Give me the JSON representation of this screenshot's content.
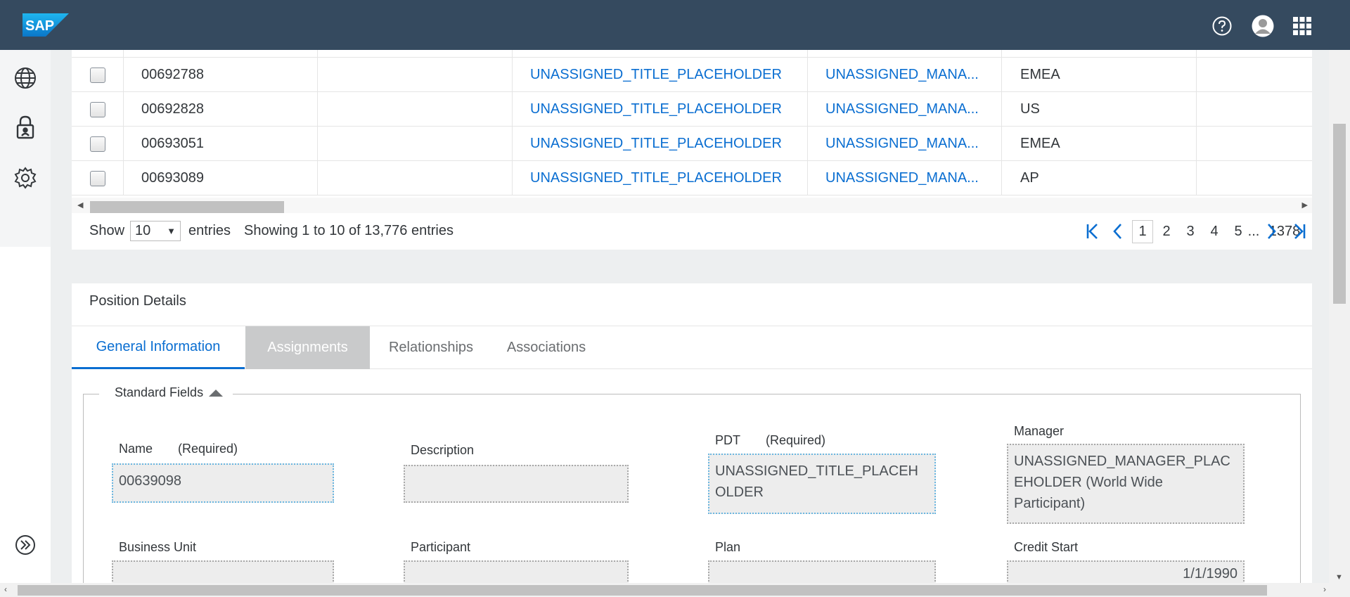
{
  "shell": {
    "logo_text": "SAP",
    "icons": [
      "help-icon",
      "user-avatar-icon",
      "app-grid-icon"
    ]
  },
  "sidenav": {
    "items": [
      "globe-icon",
      "lock-icon",
      "gear-icon"
    ],
    "expand": "expand-icon"
  },
  "table": {
    "rows": [
      {
        "id": "00692788",
        "title": "UNASSIGNED_TITLE_PLACEHOLDER",
        "manager": "UNASSIGNED_MANA...",
        "region": "EMEA"
      },
      {
        "id": "00692828",
        "title": "UNASSIGNED_TITLE_PLACEHOLDER",
        "manager": "UNASSIGNED_MANA...",
        "region": "US"
      },
      {
        "id": "00693051",
        "title": "UNASSIGNED_TITLE_PLACEHOLDER",
        "manager": "UNASSIGNED_MANA...",
        "region": "EMEA"
      },
      {
        "id": "00693089",
        "title": "UNASSIGNED_TITLE_PLACEHOLDER",
        "manager": "UNASSIGNED_MANA...",
        "region": "AP"
      }
    ]
  },
  "pager": {
    "show_label": "Show",
    "page_size": "10",
    "entries_label": "entries",
    "summary": "Showing 1 to 10 of 13,776 entries",
    "pages": [
      "1",
      "2",
      "3",
      "4",
      "5"
    ],
    "ellipsis": "...",
    "last_page": "1378"
  },
  "details": {
    "title": "Position Details",
    "tabs": [
      "General Information",
      "Assignments",
      "Relationships",
      "Associations"
    ],
    "section_label": "Standard Fields",
    "fields": {
      "name": {
        "label": "Name",
        "required": "(Required)",
        "value": "00639098"
      },
      "description": {
        "label": "Description",
        "value": ""
      },
      "pdt": {
        "label": "PDT",
        "required": "(Required)",
        "value": "UNASSIGNED_TITLE_PLACEH OLDER"
      },
      "manager": {
        "label": "Manager",
        "value": "UNASSIGNED_MANAGER_PLAC EHOLDER (World Wide Participant)"
      },
      "business_unit": {
        "label": "Business Unit"
      },
      "participant": {
        "label": "Participant"
      },
      "plan": {
        "label": "Plan"
      },
      "credit_start": {
        "label": "Credit Start",
        "value": "1/1/1990"
      }
    }
  },
  "colors": {
    "shell": "#354a5f",
    "link": "#0a6ed1",
    "background": "#edeff0"
  }
}
